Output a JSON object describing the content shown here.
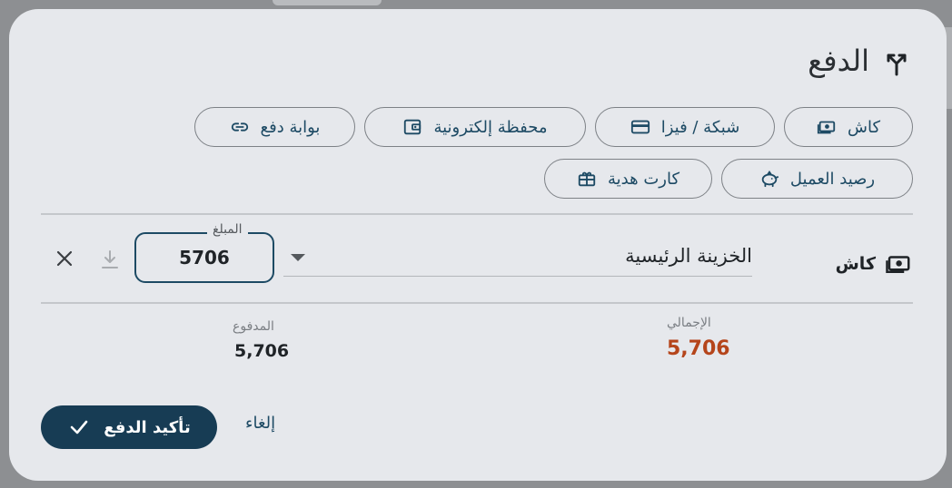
{
  "dialog": {
    "title": "الدفع",
    "title_icon": "split-arrows-icon"
  },
  "methods": [
    {
      "label": "كاش",
      "icon": "cash-icon"
    },
    {
      "label": "شبكة / فيزا",
      "icon": "credit-card-icon"
    },
    {
      "label": "محفظة إلكترونية",
      "icon": "wallet-icon"
    },
    {
      "label": "بوابة دفع",
      "icon": "link-icon"
    },
    {
      "label": "رصيد العميل",
      "icon": "piggy-bank-icon"
    },
    {
      "label": "كارت هدية",
      "icon": "gift-card-icon"
    }
  ],
  "payment_line": {
    "method_label": "كاش",
    "account": "الخزينة الرئيسية",
    "amount_label": "المبلغ",
    "amount_value": "5706"
  },
  "summary": {
    "total_label": "الإجمالي",
    "total_value": "5,706",
    "paid_label": "المدفوع",
    "paid_value": "5,706"
  },
  "actions": {
    "cancel_label": "إلغاء",
    "confirm_label": "تأكيد الدفع"
  },
  "colors": {
    "primary": "#173c54",
    "accent_text": "#1d4a64",
    "total": "#b5451b"
  }
}
